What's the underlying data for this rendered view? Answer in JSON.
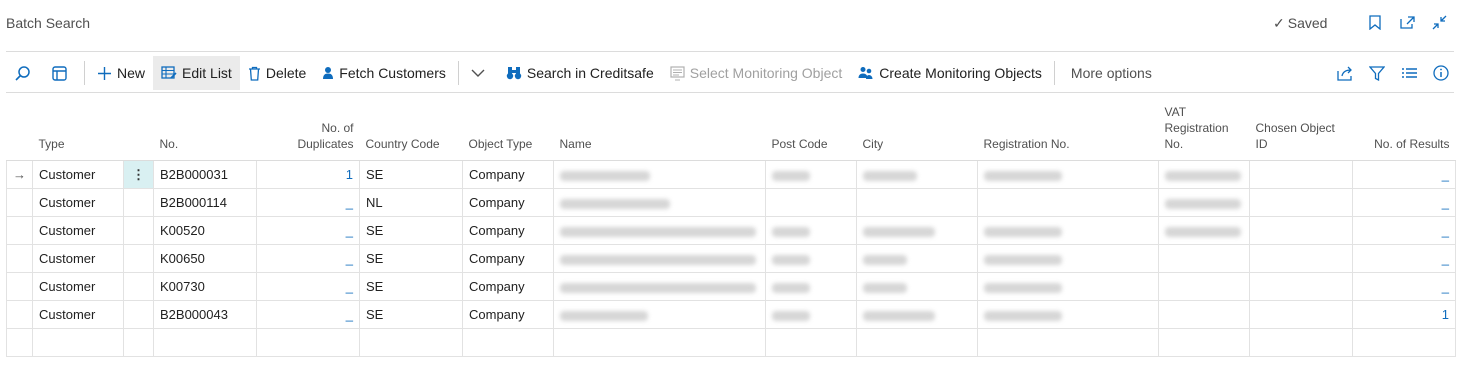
{
  "header": {
    "title": "Batch Search",
    "status": "Saved"
  },
  "toolbar": {
    "new": "New",
    "edit_list": "Edit List",
    "delete": "Delete",
    "fetch_customers": "Fetch Customers",
    "search_creditsafe": "Search in Creditsafe",
    "select_monitoring": "Select Monitoring Object",
    "create_monitoring": "Create Monitoring Objects",
    "more_options": "More options"
  },
  "columns": {
    "type": "Type",
    "no": "No.",
    "duplicates": "No. of Duplicates",
    "country": "Country Code",
    "object_type": "Object Type",
    "name": "Name",
    "post_code": "Post Code",
    "city": "City",
    "registration": "Registration No.",
    "vat": "VAT Registration No.",
    "chosen": "Chosen Object ID",
    "results": "No. of Results"
  },
  "rows": [
    {
      "type": "Customer",
      "no": "B2B000031",
      "duplicates": "1",
      "country": "SE",
      "object_type": "Company",
      "results": "_"
    },
    {
      "type": "Customer",
      "no": "B2B000114",
      "duplicates": "_",
      "country": "NL",
      "object_type": "Company",
      "results": "_"
    },
    {
      "type": "Customer",
      "no": "K00520",
      "duplicates": "_",
      "country": "SE",
      "object_type": "Company",
      "results": "_"
    },
    {
      "type": "Customer",
      "no": "K00650",
      "duplicates": "_",
      "country": "SE",
      "object_type": "Company",
      "results": "_"
    },
    {
      "type": "Customer",
      "no": "K00730",
      "duplicates": "_",
      "country": "SE",
      "object_type": "Company",
      "results": "_"
    },
    {
      "type": "Customer",
      "no": "B2B000043",
      "duplicates": "_",
      "country": "SE",
      "object_type": "Company",
      "results": "1"
    }
  ],
  "colors": {
    "accent": "#0f6cbd",
    "selected_cell": "#d9f0f2"
  },
  "icons": [
    "search-icon",
    "page-view-icon",
    "plus-icon",
    "edit-list-icon",
    "trash-icon",
    "person-icon",
    "chevron-down-icon",
    "binoculars-icon",
    "monitor-icon",
    "people-icon",
    "share-icon",
    "filter-icon",
    "list-icon",
    "info-icon",
    "bookmark-icon",
    "open-new-icon",
    "collapse-icon",
    "check-icon",
    "row-arrow-icon",
    "row-menu-icon"
  ]
}
